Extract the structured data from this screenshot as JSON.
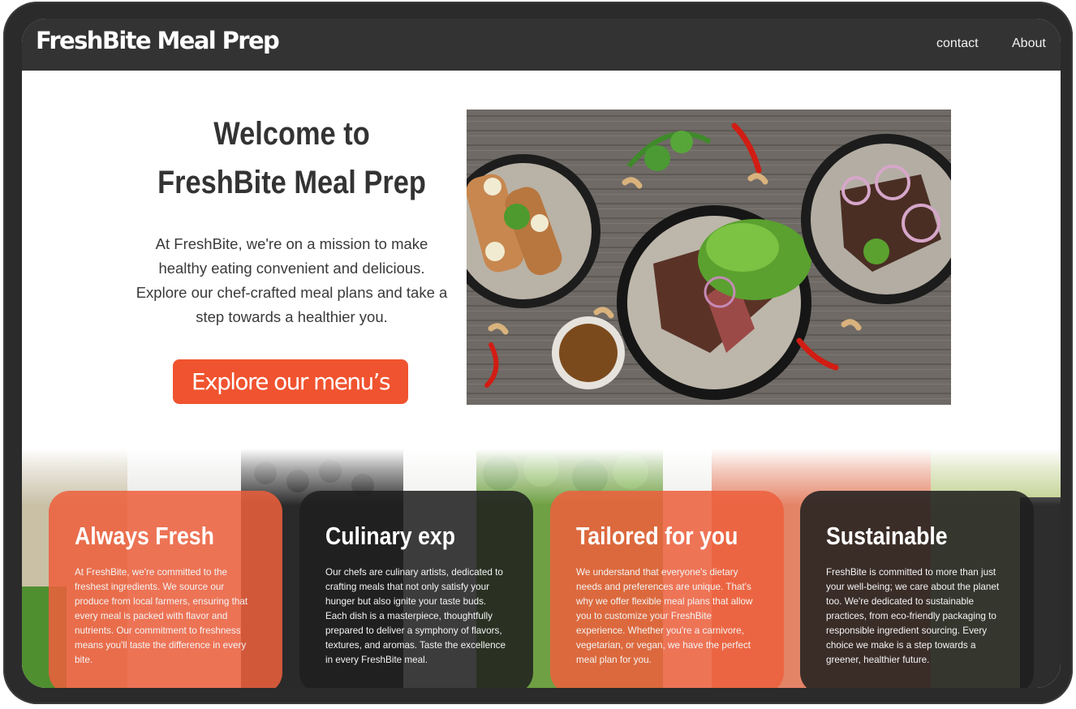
{
  "header": {
    "brand": "FreshBite Meal Prep",
    "nav": [
      {
        "label": "contact"
      },
      {
        "label": "About"
      }
    ]
  },
  "hero": {
    "title": "Welcome to FreshBite Meal Prep",
    "description": "At FreshBite, we're on a mission to make healthy eating convenient and delicious. Explore our chef-crafted meal plans and take a step towards a healthier you.",
    "cta_label": "Explore our menu’s",
    "image_name": "meal-bowls-photo"
  },
  "features": [
    {
      "title": "Always Fresh",
      "text": "At FreshBite, we're committed to the freshest ingredients. We source our produce from local farmers, ensuring that every meal is packed with flavor and nutrients. Our commitment to freshness means you'll taste the difference in every bite.",
      "style": "orange"
    },
    {
      "title": "Culinary exp",
      "text": "Our chefs are culinary artists, dedicated to crafting meals that not only satisfy your hunger but also ignite your taste buds. Each dish is a masterpiece, thoughtfully prepared to deliver a symphony of flavors, textures, and aromas. Taste the excellence in every FreshBite meal.",
      "style": "dark"
    },
    {
      "title": "Tailored for you",
      "text": "We understand that everyone's dietary needs and preferences are unique. That's why we offer flexible meal plans that allow you to customize your FreshBite experience. Whether you're a carnivore, vegetarian, or vegan, we have the perfect meal plan for you.",
      "style": "orange"
    },
    {
      "title": "Sustainable",
      "text": "FreshBite is committed to more than just your well-being; we care about the planet too. We're dedicated to sustainable practices, from eco-friendly packaging to responsible ingredient sourcing. Every choice we make is a step towards a greener, healthier future.",
      "style": "dark"
    }
  ],
  "colors": {
    "accent": "#f0532f",
    "header_bg": "#333333",
    "text": "#333333"
  }
}
